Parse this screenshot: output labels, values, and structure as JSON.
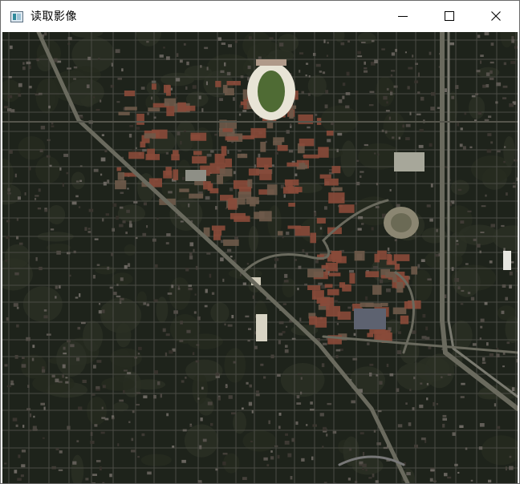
{
  "window": {
    "title": "读取影像",
    "icon": "image-window-icon",
    "controls": [
      "minimize-icon",
      "maximize-icon",
      "close-icon"
    ]
  },
  "colors": {
    "titlebar": "#ffffff",
    "ground": "#1c2119",
    "vegetation": "#252b1f",
    "street": "#4a4b44",
    "roof_red": "#8a4a3a",
    "stadium_seats": "#e8e4d6",
    "stadium_field": "#4f6b34"
  }
}
